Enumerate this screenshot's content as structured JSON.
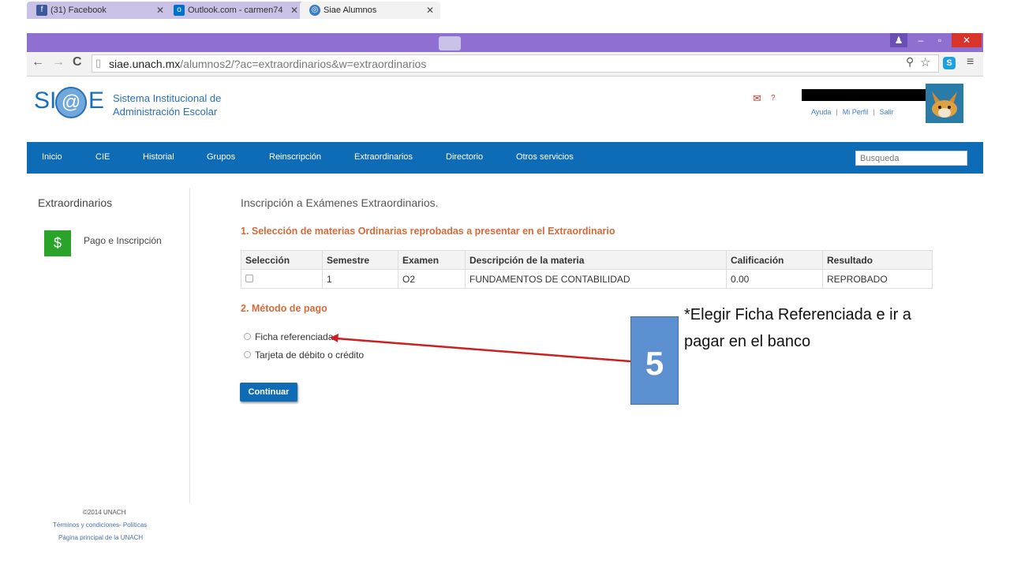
{
  "browser": {
    "tabs": [
      {
        "title": "(31) Facebook",
        "icon": "f",
        "icon_color": "#3b5998"
      },
      {
        "title": "Outlook.com - carmen74",
        "icon": "o",
        "icon_color": "#0072c6"
      },
      {
        "title": "Siae Alumnos",
        "icon": "globe",
        "icon_color": "#3a7cc3"
      }
    ],
    "url_host": "siae.unach.mx",
    "url_path": "/alumnos2/?ac=extraordinarios&w=extraordinarios"
  },
  "header": {
    "logo_si": "SI",
    "logo_at": "@",
    "logo_e": "E",
    "logo_line1": "Sistema Institucional de",
    "logo_line2": "Administración Escolar",
    "help": "?",
    "links": {
      "ayuda": "Ayuda",
      "perfil": "Mi Perfil",
      "salir": "Salir"
    }
  },
  "nav": {
    "items": [
      "Inicio",
      "CIE",
      "Historial",
      "Grupos",
      "Reinscripción",
      "Extraordinarios",
      "Directorio",
      "Otros servicios"
    ],
    "search_placeholder": "Busqueda"
  },
  "sidebar": {
    "title": "Extraordinarios",
    "item_icon": "$",
    "item_label": "Pago e Inscripción",
    "footer": {
      "copyright": "©2014 UNACH",
      "terms": "Términos y condiciones- Políticas",
      "home": "Página principal de la UNACH"
    }
  },
  "main": {
    "title": "Inscripción a Exámenes Extraordinarios.",
    "section1": "1. Selección de materias Ordinarias reprobadas a presentar en el Extraordinario",
    "table": {
      "headers": [
        "Selección",
        "Semestre",
        "Examen",
        "Descripción de la materia",
        "Calificación",
        "Resultado"
      ],
      "rows": [
        [
          "",
          "1",
          "O2",
          "FUNDAMENTOS DE CONTABILIDAD",
          "0.00",
          "REPROBADO"
        ]
      ]
    },
    "section2": "2. Método de pago",
    "payment_options": [
      "Ficha referenciada",
      "Tarjeta de débito o crédito"
    ],
    "continue_label": "Continuar"
  },
  "annotation": {
    "step": "5",
    "line1": "*Elegir Ficha Referenciada e ir a",
    "line2": "pagar en el banco"
  },
  "colors": {
    "nav": "#0e6bb6",
    "section": "#d46a3a",
    "arrow": "#cc1f1f",
    "step_box": "#5b8fd0"
  }
}
